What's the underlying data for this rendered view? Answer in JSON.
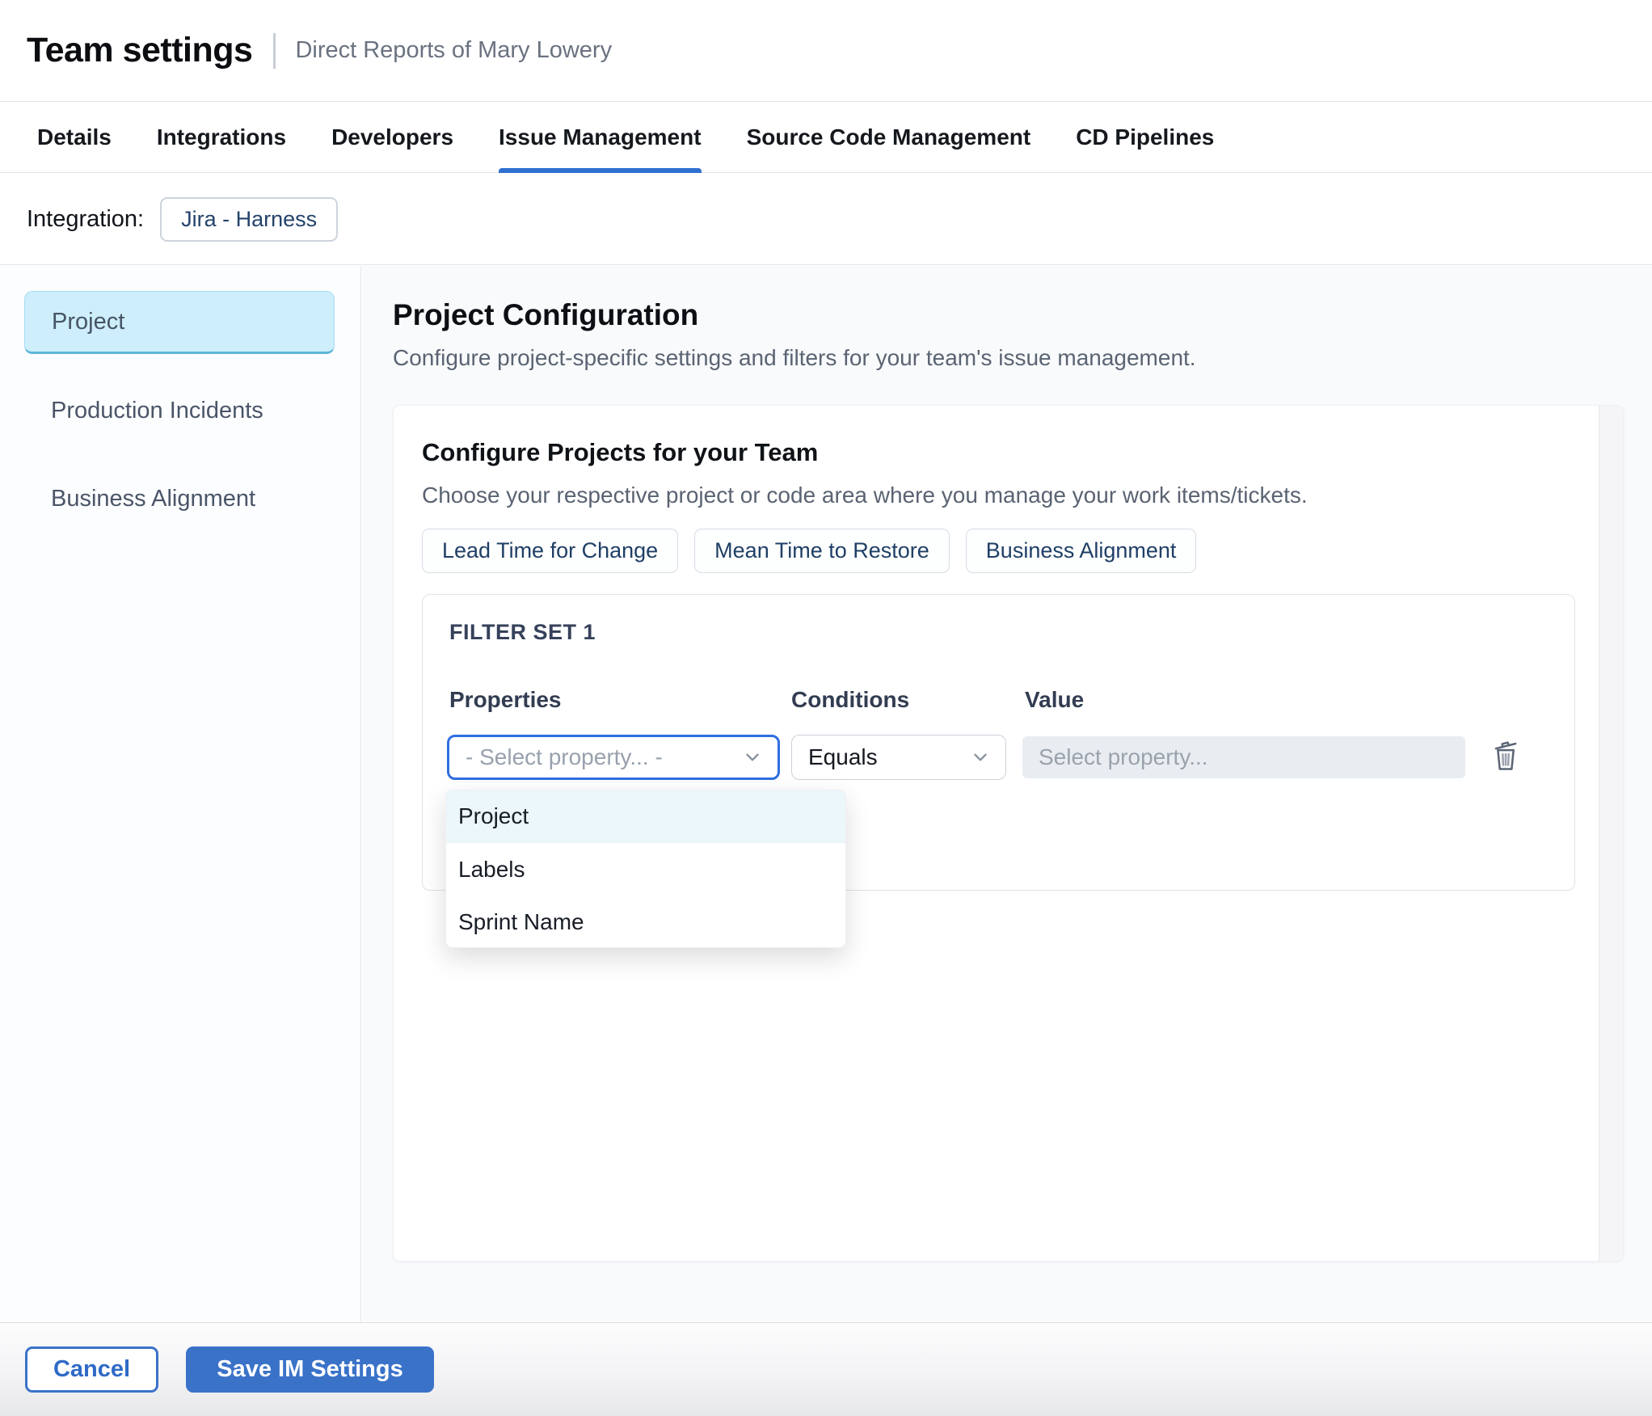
{
  "header": {
    "title": "Team settings",
    "subtitle": "Direct Reports of Mary Lowery"
  },
  "tabs": {
    "labels": [
      "Details",
      "Integrations",
      "Developers",
      "Issue Management",
      "Source Code Management",
      "CD Pipelines"
    ],
    "active": "Issue Management"
  },
  "integration": {
    "label": "Integration:",
    "chip": "Jira - Harness"
  },
  "sidebar": {
    "items": [
      "Project",
      "Production Incidents",
      "Business Alignment"
    ],
    "selected": "Project"
  },
  "main": {
    "title": "Project Configuration",
    "description": "Configure project-specific settings and filters for your team's issue management.",
    "card": {
      "title": "Configure Projects for your Team",
      "description": "Choose your respective project or code area where you manage your work items/tickets.",
      "chips": [
        "Lead Time for Change",
        "Mean Time to Restore",
        "Business Alignment"
      ],
      "filter_set": {
        "title": "FILTER SET 1",
        "columns": [
          "Properties",
          "Conditions",
          "Value"
        ],
        "property_placeholder": "- Select property... -",
        "condition_value": "Equals",
        "value_placeholder": "Select property...",
        "dropdown_options": [
          "Project",
          "Labels",
          "Sprint Name"
        ],
        "dropdown_highlighted": "Project"
      }
    }
  },
  "footer": {
    "cancel_label": "Cancel",
    "save_label": "Save IM Settings"
  },
  "icons": [
    "chevron-down-icon",
    "trash-icon"
  ],
  "colors": {
    "accent_blue": "#3a72c8",
    "tab_underline": "#2f6fd0",
    "focus_border": "#2f6ee0",
    "selected_sidebar_bg": "#cdeefa",
    "selected_sidebar_border": "#5cb6da",
    "dropdown_highlight": "#ecf7fb",
    "chip_text": "#1f3f66",
    "main_bg": "#f8fafc",
    "disabled_input_bg": "#e9edf1"
  }
}
